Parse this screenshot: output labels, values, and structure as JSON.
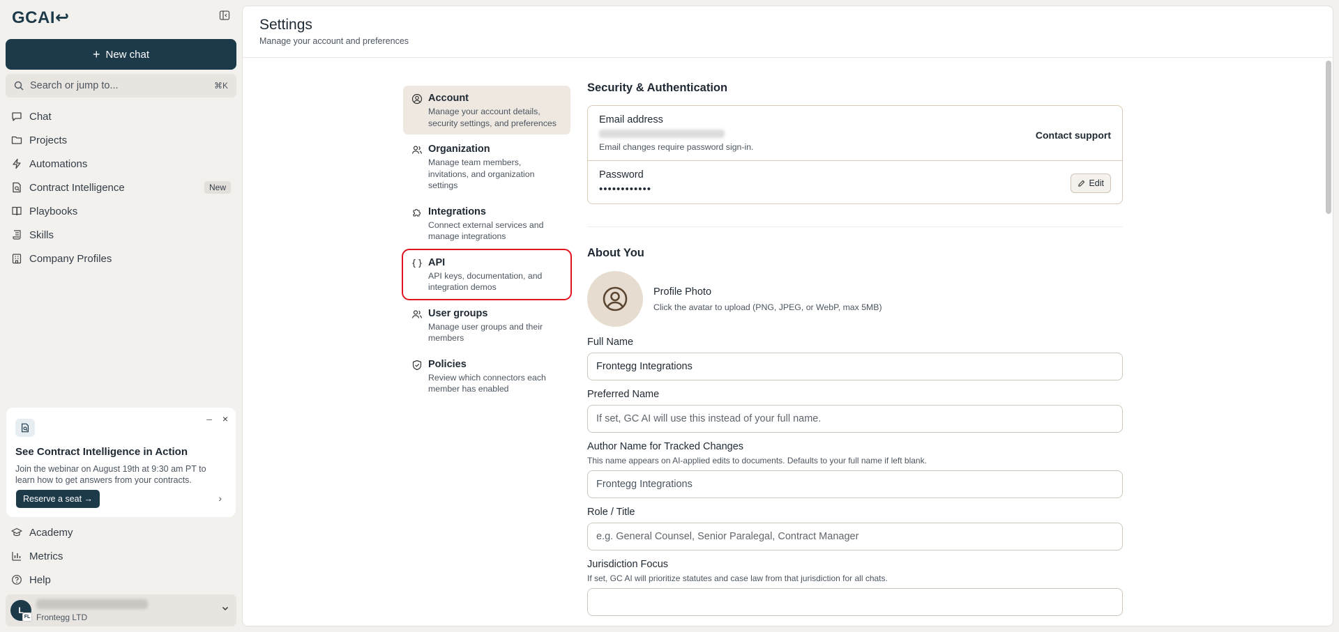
{
  "app": {
    "logo": "GCAI↩"
  },
  "sidebar": {
    "new_chat": "New chat",
    "search_placeholder": "Search or jump to...",
    "search_shortcut": "⌘K",
    "items": [
      {
        "label": "Chat",
        "icon": "chat-icon"
      },
      {
        "label": "Projects",
        "icon": "folder-icon"
      },
      {
        "label": "Automations",
        "icon": "lightning-icon"
      },
      {
        "label": "Contract Intelligence",
        "icon": "document-search-icon",
        "badge": "New"
      },
      {
        "label": "Playbooks",
        "icon": "book-icon"
      },
      {
        "label": "Skills",
        "icon": "scroll-icon"
      },
      {
        "label": "Company Profiles",
        "icon": "building-icon"
      }
    ],
    "promo": {
      "title": "See Contract Intelligence in Action",
      "text": "Join the webinar on August 19th at 9:30 am PT to learn how to get answers from your contracts.",
      "button": "Reserve a seat →",
      "minimize": "–",
      "close": "×",
      "next": "›"
    },
    "bottom_items": [
      {
        "label": "Academy",
        "icon": "graduation-cap-icon"
      },
      {
        "label": "Metrics",
        "icon": "bar-chart-icon"
      },
      {
        "label": "Help",
        "icon": "help-icon"
      }
    ],
    "user": {
      "initial": "L",
      "org_badge": "FL",
      "org": "Frontegg LTD"
    }
  },
  "header": {
    "title": "Settings",
    "subtitle": "Manage your account and preferences"
  },
  "settings_nav": [
    {
      "title": "Account",
      "desc": "Manage your account details, security settings, and preferences"
    },
    {
      "title": "Organization",
      "desc": "Manage team members, invitations, and organization settings"
    },
    {
      "title": "Integrations",
      "desc": "Connect external services and manage integrations"
    },
    {
      "title": "API",
      "desc": "API keys, documentation, and integration demos"
    },
    {
      "title": "User groups",
      "desc": "Manage user groups and their members"
    },
    {
      "title": "Policies",
      "desc": "Review which connectors each member has enabled"
    }
  ],
  "security": {
    "title": "Security & Authentication",
    "email_label": "Email address",
    "email_hint": "Email changes require password sign-in.",
    "contact_support": "Contact support",
    "password_label": "Password",
    "password_value": "••••••••••••",
    "edit": "Edit"
  },
  "about": {
    "title": "About You",
    "photo_label": "Profile Photo",
    "photo_hint": "Click the avatar to upload (PNG, JPEG, or WebP, max 5MB)",
    "full_name_label": "Full Name",
    "full_name_value": "Frontegg Integrations",
    "preferred_label": "Preferred Name",
    "preferred_placeholder": "If set, GC AI will use this instead of your full name.",
    "author_label": "Author Name for Tracked Changes",
    "author_hint": "This name appears on AI-applied edits to documents. Defaults to your full name if left blank.",
    "author_value": "Frontegg Integrations",
    "role_label": "Role / Title",
    "role_placeholder": "e.g. General Counsel, Senior Paralegal, Contract Manager",
    "jurisdiction_label": "Jurisdiction Focus",
    "jurisdiction_hint": "If set, GC AI will prioritize statutes and case law from that jurisdiction for all chats."
  }
}
